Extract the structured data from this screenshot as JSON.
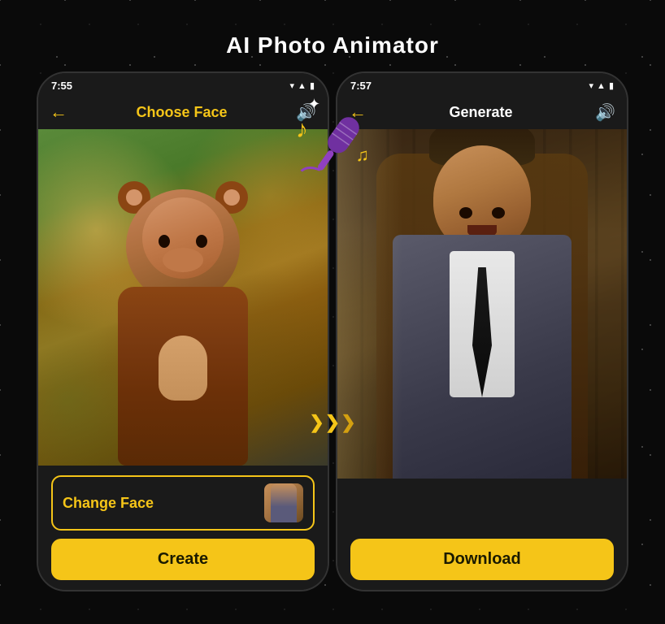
{
  "page": {
    "title": "AI Photo Animator",
    "background_color": "#0a0a0a"
  },
  "phone_left": {
    "status_time": "7:55",
    "nav_title": "Choose Face",
    "nav_title_style": "yellow",
    "change_face_label": "Change Face",
    "create_label": "Create",
    "image_subject": "child in monkey costume"
  },
  "phone_right": {
    "status_time": "7:57",
    "nav_title": "Generate",
    "nav_title_style": "white-bold",
    "download_label": "Download",
    "image_subject": "man in gray suit"
  },
  "icons": {
    "back_arrow": "←",
    "sound": "🔊",
    "signal_wifi": "▾",
    "signal_bars": "▌▌▌",
    "battery": "▮",
    "music_note_large": "♪",
    "music_note_small": "♫",
    "sparkle": "✦",
    "arrow_right": "❯",
    "microphone": "🎤"
  },
  "decorations": {
    "arrows": [
      "❯",
      "❯",
      "❯"
    ],
    "sparkle": "✦",
    "music_notes": [
      "♪",
      "♫"
    ]
  }
}
